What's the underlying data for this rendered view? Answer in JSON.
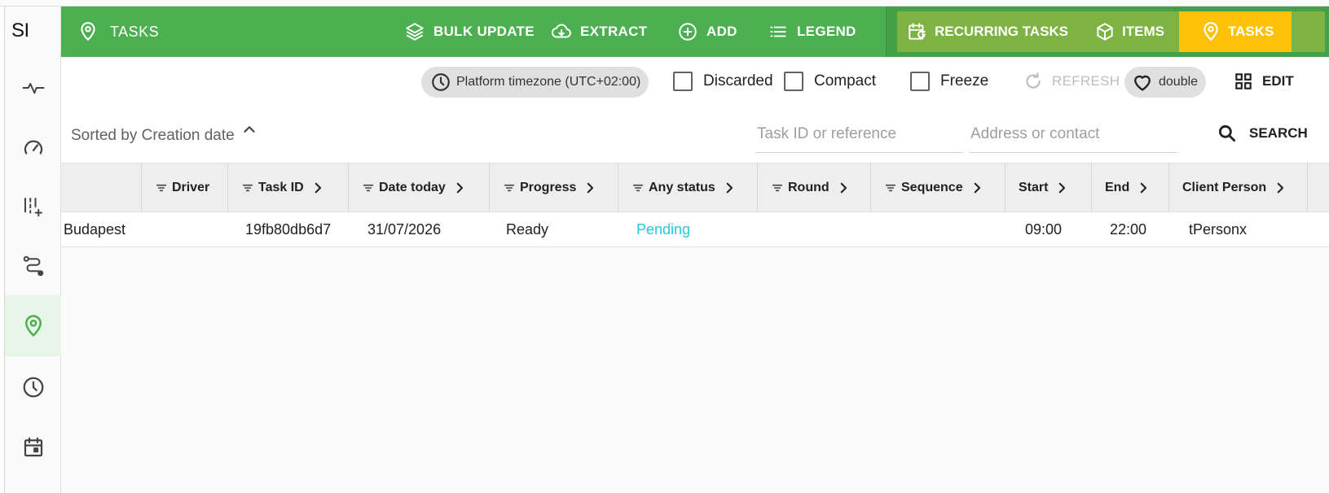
{
  "sidebar": {
    "logo": "SI",
    "items": [
      {
        "icon": "activity-icon"
      },
      {
        "icon": "speedometer-icon"
      },
      {
        "icon": "planning-icon"
      },
      {
        "icon": "route-icon"
      },
      {
        "icon": "map-pin-icon",
        "active": true
      },
      {
        "icon": "clock-icon"
      },
      {
        "icon": "calendar-icon"
      }
    ]
  },
  "topbar": {
    "title": "TASKS",
    "bulk_update": "BULK UPDATE",
    "extract": "EXTRACT",
    "add": "ADD",
    "legend": "LEGEND",
    "tabs": [
      {
        "label": "RECURRING TASKS",
        "icon": "calendar-repeat-icon"
      },
      {
        "label": "ITEMS",
        "icon": "box-icon"
      },
      {
        "label": "TASKS",
        "icon": "map-pin-icon",
        "active": true
      }
    ],
    "colors": {
      "bar": "#4caf50",
      "tab_group": "#7cb342",
      "active_tab": "#ffc107"
    }
  },
  "toolbar": {
    "timezone": "Platform timezone (UTC+02:00)",
    "discarded": "Discarded",
    "compact": "Compact",
    "freeze": "Freeze",
    "refresh": "REFRESH",
    "favorite": "double",
    "edit": "EDIT"
  },
  "sort": {
    "label": "Sorted by Creation date"
  },
  "search": {
    "task_placeholder": "Task ID or reference",
    "address_placeholder": "Address or contact",
    "button": "SEARCH"
  },
  "table": {
    "columns": [
      "Driver",
      "Task ID",
      "Date today",
      "Progress",
      "Any status",
      "Round",
      "Sequence",
      "Start",
      "End",
      "Client Person"
    ],
    "rows": [
      {
        "location": "Budapest",
        "driver": "",
        "task_id": "19fb80db6d7",
        "date": "31/07/2026",
        "progress": "Ready",
        "status": "Pending",
        "round": "",
        "sequence": "",
        "start": "09:00",
        "end": "22:00",
        "client": "tPersonx"
      }
    ],
    "status_color": "#26c6da"
  }
}
